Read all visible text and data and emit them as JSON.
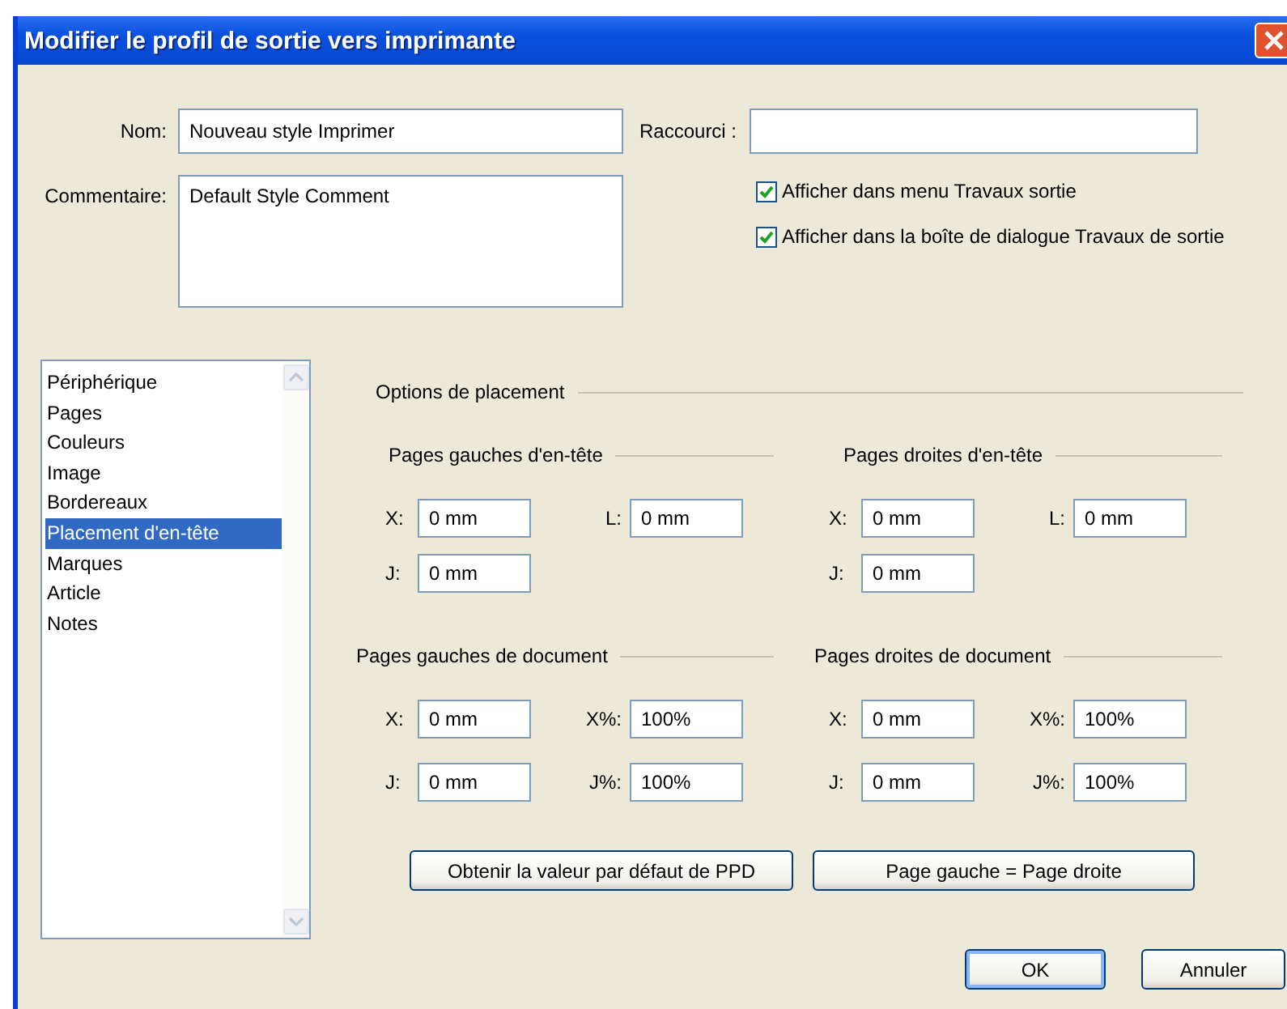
{
  "window": {
    "title": "Modifier le profil de sortie vers imprimante"
  },
  "name": {
    "label": "Nom:",
    "value": "Nouveau style Imprimer"
  },
  "shortcut": {
    "label": "Raccourci :"
  },
  "comment": {
    "label": "Commentaire:",
    "value": "Default Style Comment"
  },
  "options": [
    {
      "label": "Afficher dans menu Travaux sortie",
      "checked": true
    },
    {
      "label": "Afficher dans la boîte de dialogue Travaux de sortie",
      "checked": true
    }
  ],
  "categories": [
    {
      "label": "Périphérique",
      "selected": false
    },
    {
      "label": "Pages",
      "selected": false
    },
    {
      "label": "Couleurs",
      "selected": false
    },
    {
      "label": "Image",
      "selected": false
    },
    {
      "label": "Bordereaux",
      "selected": false
    },
    {
      "label": "Placement d'en-tête",
      "selected": true
    },
    {
      "label": "Marques",
      "selected": false
    },
    {
      "label": "Article",
      "selected": false
    },
    {
      "label": "Notes",
      "selected": false
    }
  ],
  "placement": {
    "title": "Options de placement",
    "groups": [
      {
        "title": "Pages gauches d'en-tête",
        "fields": [
          {
            "label": "X:",
            "value": "0 mm"
          },
          {
            "label": "L:",
            "value": "0 mm"
          },
          {
            "label": "J:",
            "value": "0 mm"
          }
        ]
      },
      {
        "title": "Pages droites d'en-tête",
        "fields": [
          {
            "label": "X:",
            "value": "0 mm"
          },
          {
            "label": "L:",
            "value": "0 mm"
          },
          {
            "label": "J:",
            "value": "0 mm"
          }
        ]
      },
      {
        "title": "Pages gauches de document",
        "fields": [
          {
            "label": "X:",
            "value": "0 mm"
          },
          {
            "label": "X%:",
            "value": "100%"
          },
          {
            "label": "J:",
            "value": "0 mm"
          },
          {
            "label": "J%:",
            "value": "100%"
          }
        ]
      },
      {
        "title": "Pages droites de document",
        "fields": [
          {
            "label": "X:",
            "value": "0 mm"
          },
          {
            "label": "X%:",
            "value": "100%"
          },
          {
            "label": "J:",
            "value": "0 mm"
          },
          {
            "label": "J%:",
            "value": "100%"
          }
        ]
      }
    ]
  },
  "actions": [
    "Obtenir la valeur par défaut de PPD",
    "Page gauche = Page droite"
  ],
  "buttons": [
    {
      "label": "OK",
      "default": true
    },
    {
      "label": "Annuler",
      "default": false
    }
  ]
}
